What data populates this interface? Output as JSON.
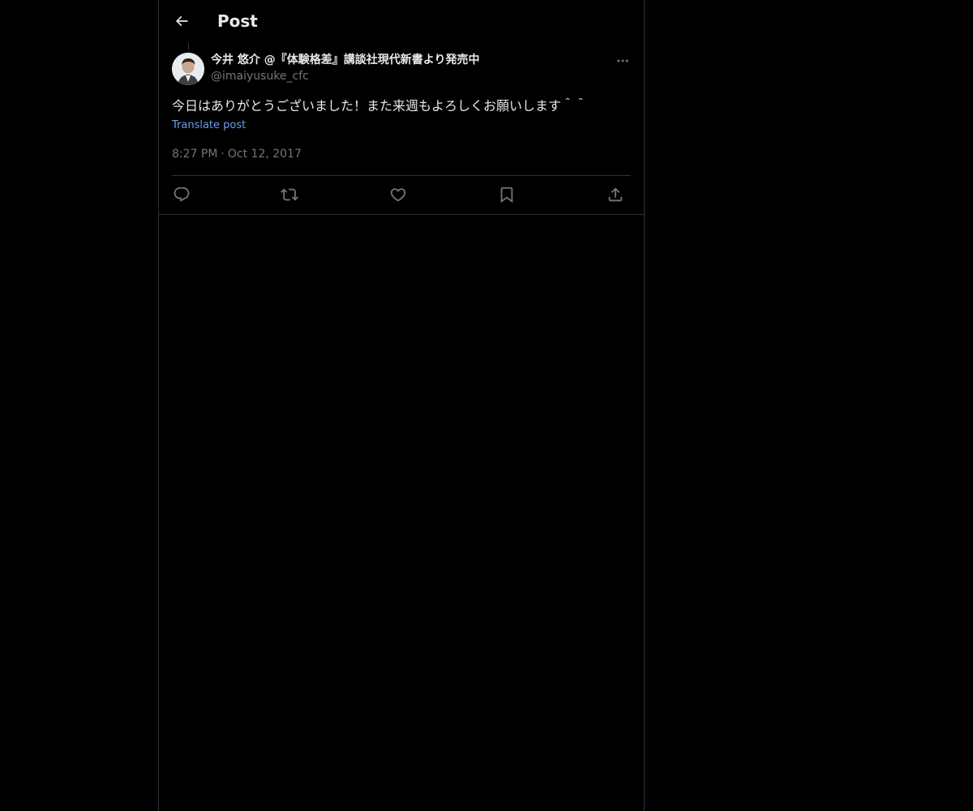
{
  "header": {
    "title": "Post",
    "back_icon": "arrow-left-icon"
  },
  "post": {
    "author_name": "今井 悠介 @『体験格差』講談社現代新書より発売中",
    "author_handle": "@imaiyusuke_cfc",
    "text": "今日はありがとうございました！また来週もよろしくお願いします＾＾",
    "translate_label": "Translate post",
    "time": "8:27 PM",
    "separator": "·",
    "date": "Oct 12, 2017",
    "more_icon": "more-horizontal-icon"
  },
  "actions": [
    {
      "name": "reply",
      "icon": "reply-icon"
    },
    {
      "name": "repost",
      "icon": "repost-icon"
    },
    {
      "name": "like",
      "icon": "like-icon"
    },
    {
      "name": "bookmark",
      "icon": "bookmark-icon"
    },
    {
      "name": "share",
      "icon": "share-icon"
    }
  ],
  "colors": {
    "background": "#000000",
    "text_primary": "#e7e9ea",
    "text_secondary": "#71767b",
    "link": "#6b9eea",
    "border": "#2f3336"
  }
}
